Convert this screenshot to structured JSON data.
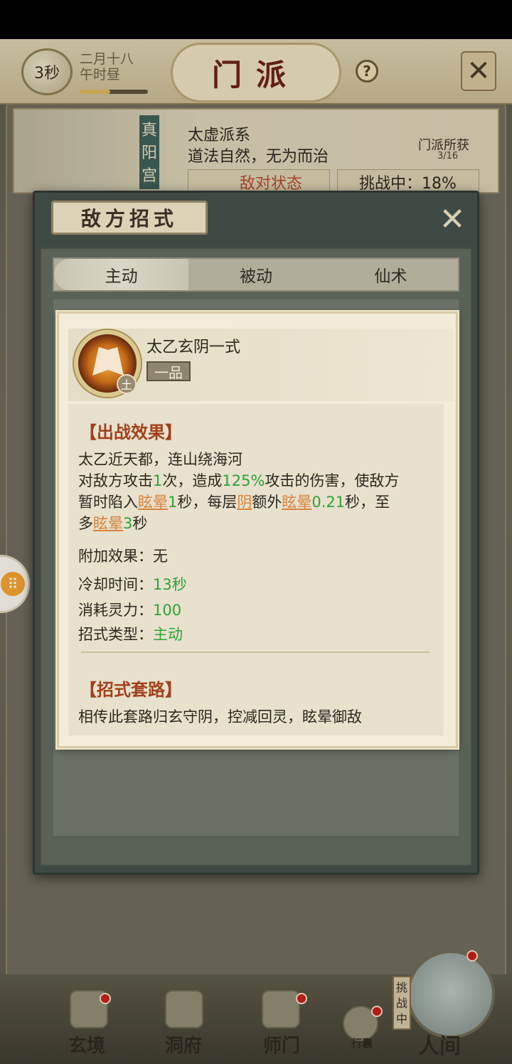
{
  "header": {
    "timer": "3秒",
    "lunar_date": "二月十八",
    "lunar_time": "午时昼",
    "title": "门派",
    "help": "?",
    "time_progress": 0.45
  },
  "sect": {
    "seal": "真阳宫",
    "name": "太虚派系",
    "motto": "道法自然，无为而治",
    "reward_label": "门派所获",
    "reward_count": "3/16",
    "hostile_label": "敌对状态",
    "challenge_status": "挑战中：18%"
  },
  "dialog": {
    "title": "敌方招式",
    "tabs": [
      "主动",
      "被动",
      "仙术"
    ],
    "active_tab": 0
  },
  "skill": {
    "name": "太乙玄阴一式",
    "grade": "一品",
    "element": "土",
    "effect_title": "【出战效果】",
    "flavor": "太乙近天都，连山绕海河",
    "desc": {
      "p1": "对敌方攻击",
      "hits": "1",
      "p2": "次，造成",
      "pct": "125%",
      "p3": "攻击的伤害，使敌方",
      "p4": "暂时陷入",
      "stun1": "眩晕",
      "dur1": "1",
      "p5": "秒，每层",
      "yin": "阴",
      "p6": "额外",
      "stun2": "眩晕",
      "dur2": "0.21",
      "p7": "秒，至",
      "p8": "多",
      "stun3": "眩晕",
      "dur3": "3",
      "p9": "秒"
    },
    "extra_label": "附加效果：",
    "extra_value": "无",
    "cooldown_label": "冷却时间：",
    "cooldown_value": "13秒",
    "cost_label": "消耗灵力：",
    "cost_value": "100",
    "type_label": "招式类型：",
    "type_value": "主动",
    "routine_title": "【招式套路】",
    "routine_desc": "相传此套路归玄守阴，控减回灵，眩晕御敌"
  },
  "nav": {
    "items": [
      "玄境",
      "洞府",
      "师门",
      "行囊"
    ],
    "world": "人间",
    "challenge_tag": "挑战中"
  },
  "colors": {
    "accent_green": "#30a23a",
    "keyword_orange": "#d7843c",
    "section_red": "#a3401c",
    "alert_red": "#c0201a"
  }
}
